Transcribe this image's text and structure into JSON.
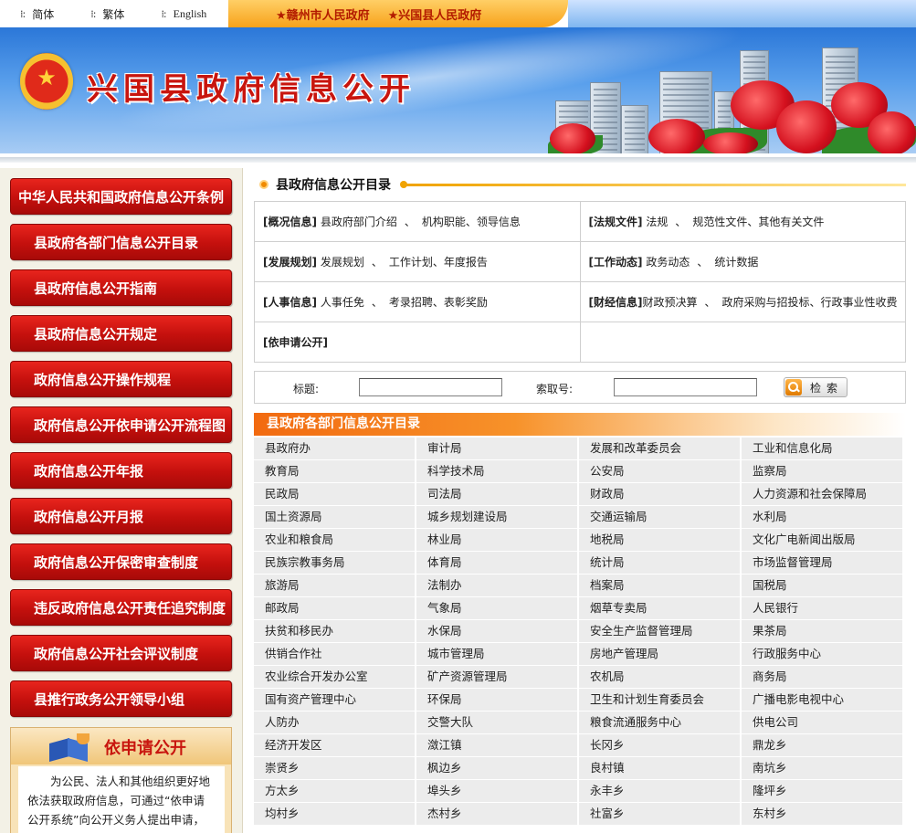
{
  "lang_bar": {
    "items": [
      "简体",
      "繁体",
      "English"
    ],
    "links": [
      "★赣州市人民政府",
      "★兴国县人民政府"
    ]
  },
  "banner": {
    "title": "兴国县政府信息公开"
  },
  "sidebar": {
    "items": [
      "中华人民共和国政府信息公开条例",
      "县政府各部门信息公开目录",
      "县政府信息公开指南",
      "县政府信息公开规定",
      "政府信息公开操作规程",
      "政府信息公开依申请公开流程图",
      "政府信息公开年报",
      "政府信息公开月报",
      "政府信息公开保密审查制度",
      "违反政府信息公开责任追究制度",
      "政府信息公开社会评议制度",
      "县推行政务公开领导小组"
    ],
    "apply": {
      "title": "依申请公开",
      "text": "为公民、法人和其他组织更好地依法获取政府信息，可通过“依申请公开系统”向公开义务人提出申请，经审查同意后在《目录》进行公示。"
    }
  },
  "catalog": {
    "title": "县政府信息公开目录",
    "rows": [
      [
        {
          "label": "[概况信息]",
          "items": [
            "县政府部门介绍",
            "机构职能",
            "领导信息"
          ]
        },
        {
          "label": "[法规文件]",
          "items": [
            "法规",
            "规范性文件",
            "其他有关文件"
          ]
        }
      ],
      [
        {
          "label": "[发展规划]",
          "items": [
            "发展规划",
            "工作计划",
            "年度报告"
          ]
        },
        {
          "label": "[工作动态]",
          "items": [
            "政务动态",
            "统计数据"
          ]
        }
      ],
      [
        {
          "label": "[人事信息]",
          "items": [
            "人事任免",
            "考录招聘",
            "表彰奖励"
          ]
        },
        {
          "label": "[财经信息]",
          "items": [
            "财政预决算",
            "政府采购与招投标",
            "行政事业性收费"
          ]
        }
      ],
      [
        {
          "label": "[依申请公开]",
          "items": []
        },
        {
          "label": "",
          "items": []
        }
      ]
    ]
  },
  "search": {
    "title_label": "标题:",
    "index_label": "索取号:",
    "button": "检索"
  },
  "departments": {
    "title": "县政府各部门信息公开目录",
    "items": [
      "县政府办",
      "审计局",
      "发展和改革委员会",
      "工业和信息化局",
      "教育局",
      "科学技术局",
      "公安局",
      "监察局",
      "民政局",
      "司法局",
      "财政局",
      "人力资源和社会保障局",
      "国土资源局",
      "城乡规划建设局",
      "交通运输局",
      "水利局",
      "农业和粮食局",
      "林业局",
      "地税局",
      "文化广电新闻出版局",
      "民族宗教事务局",
      "体育局",
      "统计局",
      "市场监督管理局",
      "旅游局",
      "法制办",
      "档案局",
      "国税局",
      "邮政局",
      "气象局",
      "烟草专卖局",
      "人民银行",
      "扶贫和移民办",
      "水保局",
      "安全生产监督管理局",
      "果茶局",
      "供销合作社",
      "城市管理局",
      "房地产管理局",
      "行政服务中心",
      "农业综合开发办公室",
      "矿产资源管理局",
      "农机局",
      "商务局",
      "国有资产管理中心",
      "环保局",
      "卫生和计划生育委员会",
      "广播电影电视中心",
      "人防办",
      "交警大队",
      "粮食流通服务中心",
      "供电公司",
      "经济开发区",
      "潋江镇",
      "长冈乡",
      "鼎龙乡",
      "崇贤乡",
      "枫边乡",
      "良村镇",
      "南坑乡",
      "方太乡",
      "埠头乡",
      "永丰乡",
      "隆坪乡",
      "均村乡",
      "杰村乡",
      "社富乡",
      "东村乡"
    ]
  }
}
